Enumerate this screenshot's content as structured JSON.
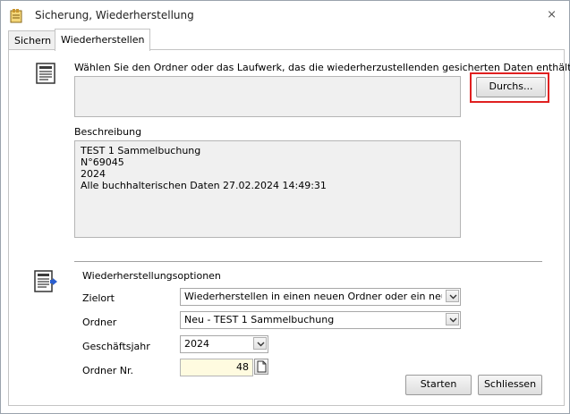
{
  "window": {
    "title": "Sicherung, Wiederherstellung",
    "close_glyph": "⨯"
  },
  "tabs": [
    {
      "label": "Sichern"
    },
    {
      "label": "Wiederherstellen"
    }
  ],
  "select_folder": {
    "instruction": "Wählen Sie den Ordner oder das Laufwerk, das die wiederherzustellenden gesicherten Daten enthält",
    "path_value": "",
    "browse_label": "Durchs..."
  },
  "description": {
    "label": "Beschreibung",
    "lines": [
      "TEST 1 Sammelbuchung",
      "N°69045",
      "2024",
      "Alle buchhalterischen Daten 27.02.2024 14:49:31"
    ]
  },
  "options": {
    "heading": "Wiederherstellungsoptionen",
    "zielort_label": "Zielort",
    "zielort_value": "Wiederherstellen in einen neuen Ordner oder ein neues Gesch",
    "ordner_label": "Ordner",
    "ordner_value": "Neu - TEST 1 Sammelbuchung",
    "jahr_label": "Geschäftsjahr",
    "jahr_value": "2024",
    "nr_label": "Ordner Nr.",
    "nr_value": "48"
  },
  "buttons": {
    "start_label": "Starten",
    "close_label": "Schliessen"
  },
  "colors": {
    "highlight": "#e02020",
    "field_bg": "#f0f0f0",
    "number_bg": "#fffbe0"
  },
  "icons": [
    "app-icon",
    "document-list-icon",
    "options-document-icon",
    "chevron-down-icon",
    "new-document-icon"
  ]
}
